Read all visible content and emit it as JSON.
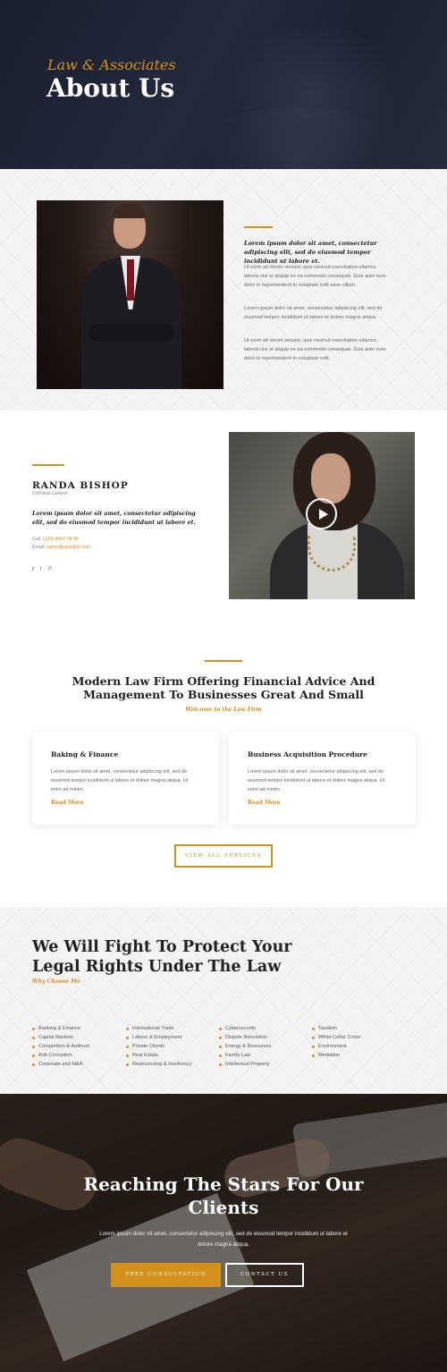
{
  "hero": {
    "kicker": "Law & Associates",
    "title": "About Us"
  },
  "about": {
    "lead": "Lorem ipsum dolor sit amet, consectetur adipiscing elit, sed do eiusmod tempor incididunt ut labore et.",
    "paragraphs": [
      "Ut enim ad minim veniam, quis nostrud exercitation ullamco laboris nisi ut aliquip ex ea commodo consequat. Duis aute irure dolor in reprehenderit in voluptate velit esse cillum.",
      "Lorem ipsum dolor sit amet, consectetur adipiscing elit, sed do eiusmod tempor incididunt ut labore et dolore magna aliqua.",
      "Ut enim ad minim veniam, quis nostrud exercitation ullamco laboris nisi ut aliquip ex ea commodo consequat. Duis aute irure dolor in reprehenderit in voluptate velit."
    ]
  },
  "bio": {
    "name": "RANDA BISHOP",
    "role": "Criminal Lawyer",
    "quote": "Lorem ipsum dolor sit amet, consectetur adipiscing elit, sed do eiusmod tempor incididunt ut labore et.",
    "call_label": "Call:",
    "call_value": "(123) 4567-78-90",
    "email_label": "Email:",
    "email_value": "name@example.com",
    "social": [
      "twitter-icon",
      "facebook-icon",
      "pinterest-icon"
    ]
  },
  "services": {
    "heading": "Modern Law Firm Offering Financial Advice And Management To Businesses Great And Small",
    "subheading": "Welcome to the Law Firm",
    "cards": [
      {
        "title": "Baking & Finance",
        "text": "Lorem ipsum dolor sit amet, consectetur adipiscing elit, sed do eiusmod tempor incididunt ut labore et dolore magna aliqua. Ut enim ad minim.",
        "link": "Read More"
      },
      {
        "title": "Business Acquisition Procedure",
        "text": "Lorem ipsum dolor sit amet, consectetur adipiscing elit, sed do eiusmod tempor incididunt ut labore et dolore magna aliqua. Ut enim ad minim.",
        "link": "Read More"
      }
    ],
    "view_all": "VIEW ALL SERVICES"
  },
  "why": {
    "heading": "We Will Fight To Protect Your Legal Rights Under The Law",
    "subheading": "Why Choose Me",
    "columns": [
      [
        "Banking & Finance",
        "Capital Markets",
        "Competition & Antitrust",
        "Anti-Corruption",
        "Corporate and M&A"
      ],
      [
        "International Trade",
        "Labour & Employment",
        "Private Clients",
        "Real Estate",
        "Restructuring & Insolvency"
      ],
      [
        "Cybersecurity",
        "Dispute Resolution",
        "Energy & Resources",
        "Family Law",
        "Intellectual Property"
      ],
      [
        "Taxation",
        "White-Collar Crime",
        "Environment",
        "Mediation"
      ]
    ]
  },
  "cta": {
    "heading": "Reaching The Stars For Our Clients",
    "text": "Lorem ipsum dolor sit amet, consectetur adipiscing elit, sed do eiusmod tempor incididunt ut labore et dolore magna aliqua.",
    "primary": "FREE CONSULTATION",
    "secondary": "CONTACT US"
  },
  "colors": {
    "accent": "#d4911b",
    "hero_bg": "#1c2232",
    "section_bg": "#f3f3f3"
  }
}
